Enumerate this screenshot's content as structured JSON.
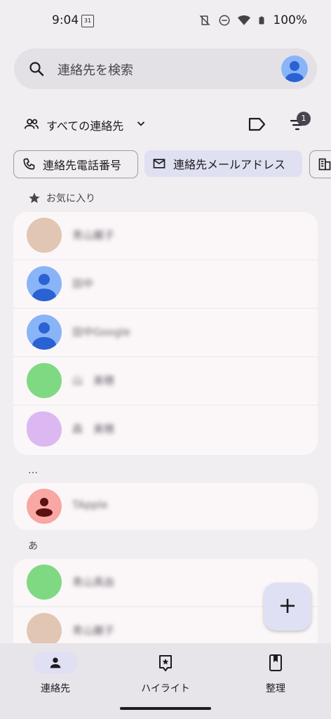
{
  "status": {
    "time": "9:04",
    "calendar_day": "31",
    "battery": "100%",
    "icons": [
      "vibrate-off-icon",
      "dnd-icon",
      "wifi-icon",
      "battery-icon"
    ]
  },
  "search": {
    "placeholder": "連絡先を検索"
  },
  "filter": {
    "account_label": "すべての連絡先",
    "filter_count": "1"
  },
  "chips": [
    {
      "label": "連絡先電話番号",
      "icon": "phone-icon"
    },
    {
      "label": "連絡先メールアドレス",
      "icon": "mail-icon"
    },
    {
      "label": "",
      "icon": "building-icon"
    }
  ],
  "sections": {
    "favorites": {
      "title": "お気に入り",
      "icon": "star-icon"
    },
    "dots": {
      "title": "…"
    },
    "a": {
      "title": "あ"
    }
  },
  "contacts": {
    "favorites": [
      {
        "name": "青山麗子",
        "avatar_color": "#e1c6b3",
        "avatar_type": "photo"
      },
      {
        "name": "田中",
        "avatar_color": "#8ab4f8",
        "avatar_type": "default"
      },
      {
        "name": "田中Google",
        "avatar_color": "#8ab4f8",
        "avatar_type": "default"
      },
      {
        "name": "山　美穂",
        "avatar_color": "#7fd983",
        "avatar_type": "solid"
      },
      {
        "name": "森　美穂",
        "avatar_color": "#dbb8f2",
        "avatar_type": "solid"
      }
    ],
    "dots": [
      {
        "name": "TApple",
        "avatar_color": "#f8a7a2",
        "avatar_type": "default-red"
      }
    ],
    "a": [
      {
        "name": "青山真由",
        "avatar_color": "#7fd983",
        "avatar_type": "solid"
      },
      {
        "name": "青山麗子",
        "avatar_color": "#e1c6b3",
        "avatar_type": "photo"
      }
    ]
  },
  "fab": {
    "label": "+"
  },
  "nav": [
    {
      "label": "連絡先",
      "icon": "person-icon",
      "active": true
    },
    {
      "label": "ハイライト",
      "icon": "highlight-icon",
      "active": false
    },
    {
      "label": "整理",
      "icon": "bookmark-book-icon",
      "active": false
    }
  ],
  "colors": {
    "background": "#f1eef2",
    "card": "#fbf7f8",
    "search_bar": "#e4e1e6",
    "accent_chip": "#dfe0f1",
    "nav_active_pill": "#dfe0f3"
  }
}
